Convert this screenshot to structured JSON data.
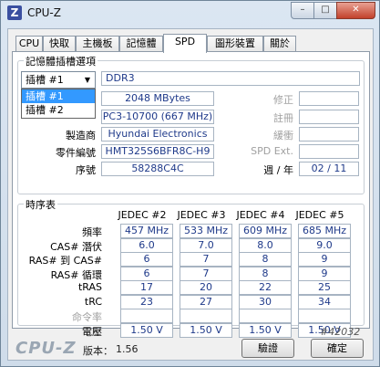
{
  "window": {
    "title": "CPU-Z",
    "icon_glyph": "Z",
    "minimize_label": "–",
    "maximize_label": "□",
    "close_label": "✕"
  },
  "tabs": [
    {
      "label": "CPU"
    },
    {
      "label": "快取"
    },
    {
      "label": "主機板"
    },
    {
      "label": "記憶體"
    },
    {
      "label": "SPD"
    },
    {
      "label": "圖形裝置"
    },
    {
      "label": "關於"
    }
  ],
  "active_tab": "SPD",
  "slot": {
    "group_title": "記憶體插槽選項",
    "selected": "插槽 #1",
    "options": [
      "插槽 #1",
      "插槽 #2"
    ],
    "highlighted": "插槽 #1",
    "type_value": "DDR3",
    "module_size": "2048 MBytes",
    "max_bandwidth": "PC3-10700 (667 MHz)",
    "manufacturer_label": "製造商",
    "manufacturer": "Hyundai Electronics",
    "part_number_label": "零件編號",
    "part_number": "HMT325S6BFR8C-H9",
    "serial_label": "序號",
    "serial": "58288C4C",
    "correction_label": "修正",
    "registered_label": "註冊",
    "buffered_label": "緩衝",
    "spd_ext_label": "SPD Ext.",
    "week_year_label": "週 / 年",
    "week_year": "02 / 11"
  },
  "timings": {
    "group_title": "時序表",
    "columns": [
      "JEDEC #2",
      "JEDEC #3",
      "JEDEC #4",
      "JEDEC #5"
    ],
    "rows": [
      {
        "label": "頻率",
        "values": [
          "457 MHz",
          "533 MHz",
          "609 MHz",
          "685 MHz"
        ],
        "dim": false
      },
      {
        "label": "CAS# 潛伏",
        "values": [
          "6.0",
          "7.0",
          "8.0",
          "9.0"
        ],
        "dim": false
      },
      {
        "label": "RAS# 到 CAS#",
        "values": [
          "6",
          "7",
          "8",
          "9"
        ],
        "dim": false
      },
      {
        "label": "RAS# 循環",
        "values": [
          "6",
          "7",
          "8",
          "9"
        ],
        "dim": false
      },
      {
        "label": "tRAS",
        "values": [
          "17",
          "20",
          "22",
          "25"
        ],
        "dim": false
      },
      {
        "label": "tRC",
        "values": [
          "23",
          "27",
          "30",
          "34"
        ],
        "dim": false
      },
      {
        "label": "命令率",
        "values": [
          "",
          "",
          "",
          ""
        ],
        "dim": true
      },
      {
        "label": "電壓",
        "values": [
          "1.50 V",
          "1.50 V",
          "1.50 V",
          "1.50 V"
        ],
        "dim": false
      }
    ]
  },
  "footer": {
    "brand": "CPU-Z",
    "version_label": "版本：",
    "version": "1.56",
    "validate_label": "驗證",
    "ok_label": "確定"
  },
  "watermark": "#42032"
}
